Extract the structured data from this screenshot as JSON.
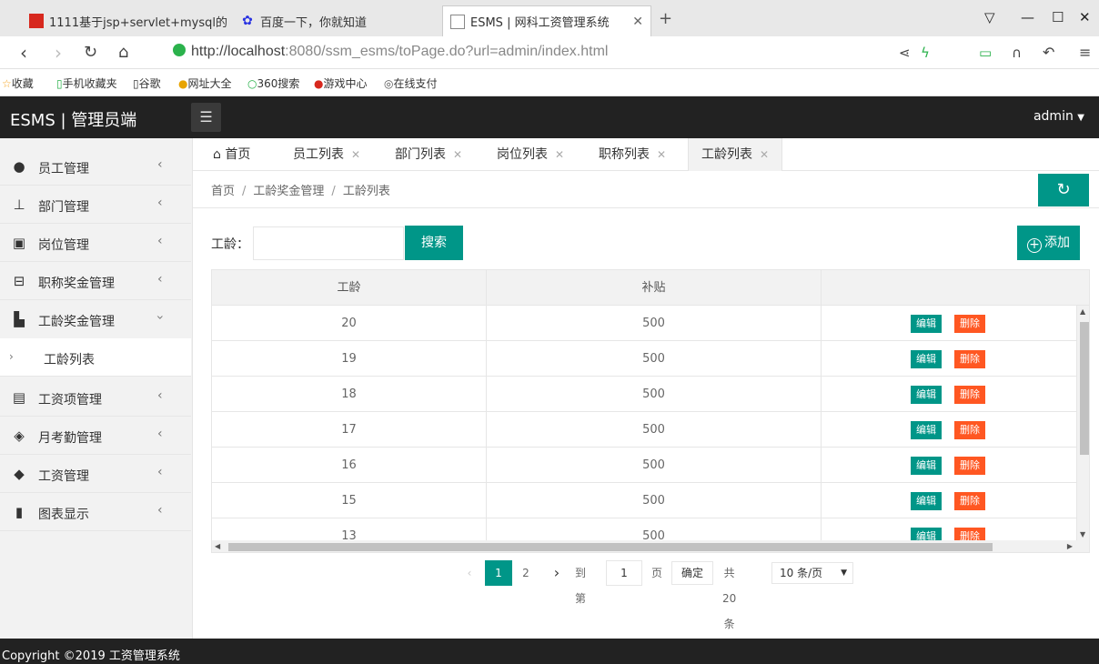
{
  "browser": {
    "tabs": [
      {
        "title": "1111基于jsp+servlet+mysql的"
      },
      {
        "title": "百度一下，你就知道"
      },
      {
        "title": "ESMS | 网科工资管理系统"
      }
    ],
    "url_host": "http://localhost",
    "url_rest": ":8080/ssm_esms/toPage.do?url=admin/index.html",
    "bookmarks": [
      "收藏",
      "手机收藏夹",
      "谷歌",
      "网址大全",
      "360搜索",
      "游戏中心",
      "在线支付"
    ]
  },
  "header": {
    "brand": "ESMS | 管理员端",
    "user": "admin"
  },
  "sidebar": {
    "items": [
      {
        "label": "员工管理"
      },
      {
        "label": "部门管理"
      },
      {
        "label": "岗位管理"
      },
      {
        "label": "职称奖金管理"
      },
      {
        "label": "工龄奖金管理"
      },
      {
        "label": "工资项管理"
      },
      {
        "label": "月考勤管理"
      },
      {
        "label": "工资管理"
      },
      {
        "label": "图表显示"
      }
    ],
    "sub_item": "工龄列表"
  },
  "page_tabs": [
    "首页",
    "员工列表",
    "部门列表",
    "岗位列表",
    "职称列表",
    "工龄列表"
  ],
  "breadcrumb": [
    "首页",
    "工龄奖金管理",
    "工龄列表"
  ],
  "search": {
    "label": "工龄：",
    "value": "",
    "button": "搜索"
  },
  "add_button": "添加",
  "table": {
    "columns": [
      "工龄",
      "补贴"
    ],
    "edit_label": "编辑",
    "delete_label": "删除",
    "rows": [
      [
        "20",
        "500"
      ],
      [
        "19",
        "500"
      ],
      [
        "18",
        "500"
      ],
      [
        "17",
        "500"
      ],
      [
        "16",
        "500"
      ],
      [
        "15",
        "500"
      ],
      [
        "13",
        "500"
      ]
    ]
  },
  "pagination": {
    "pages": [
      "1",
      "2"
    ],
    "goto_label": "到第",
    "page_input": "1",
    "page_unit": "页",
    "confirm": "确定",
    "total": "共 20 条",
    "page_size": "10 条/页"
  },
  "footer": "Copyright ©2019 工资管理系统",
  "colors": {
    "primary": "#009688",
    "danger": "#ff5722",
    "dark": "#222222"
  }
}
